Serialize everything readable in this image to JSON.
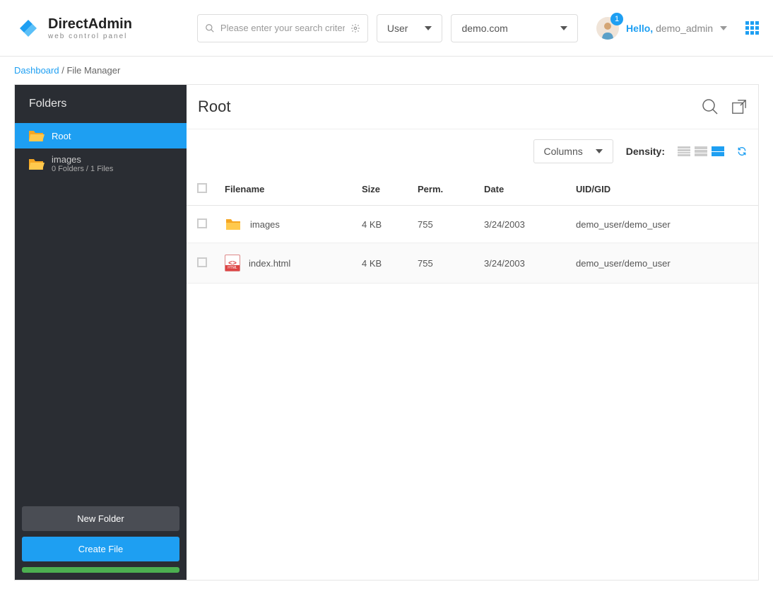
{
  "header": {
    "logo_title": "DirectAdmin",
    "logo_subtitle": "web control panel",
    "search_placeholder": "Please enter your search criteria",
    "user_dropdown": "User",
    "domain_dropdown": "demo.com",
    "greeting_prefix": "Hello, ",
    "username": "demo_admin",
    "notification_count": "1"
  },
  "breadcrumb": {
    "root": "Dashboard",
    "sep": " / ",
    "current": "File Manager"
  },
  "sidebar": {
    "title": "Folders",
    "items": [
      {
        "label": "Root",
        "active": true
      },
      {
        "label": "images",
        "sub": "0 Folders / 1 Files",
        "active": false
      }
    ],
    "new_folder": "New Folder",
    "create_file": "Create File"
  },
  "content": {
    "title": "Root",
    "columns_btn": "Columns",
    "density_label": "Density:",
    "table": {
      "headers": [
        "Filename",
        "Size",
        "Perm.",
        "Date",
        "UID/GID"
      ],
      "rows": [
        {
          "type": "folder",
          "name": "images",
          "size": "4 KB",
          "perm": "755",
          "date": "3/24/2003",
          "uidgid": "demo_user/demo_user"
        },
        {
          "type": "html",
          "name": "index.html",
          "size": "4 KB",
          "perm": "755",
          "date": "3/24/2003",
          "uidgid": "demo_user/demo_user"
        }
      ]
    }
  }
}
